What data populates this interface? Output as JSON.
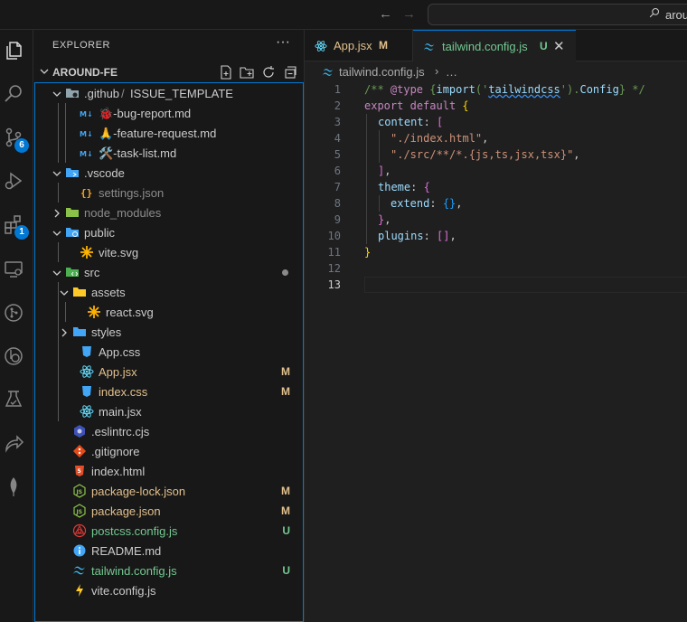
{
  "titlebar": {
    "search_text": "arou"
  },
  "activity_bar": {
    "items": [
      {
        "icon": "files-icon"
      },
      {
        "icon": "search-icon"
      },
      {
        "icon": "source-control-icon",
        "badge": "6"
      },
      {
        "icon": "run-debug-icon"
      },
      {
        "icon": "extensions-icon",
        "badge": "1"
      },
      {
        "icon": "remote-explorer-icon"
      },
      {
        "icon": "git-graph-icon"
      },
      {
        "icon": "gitlens-icon"
      },
      {
        "icon": "testing-icon"
      },
      {
        "icon": "live-share-icon"
      },
      {
        "icon": "mongodb-icon"
      }
    ]
  },
  "sidebar": {
    "title": "EXPLORER",
    "more": "···",
    "section_title": "AROUND-FE",
    "section_actions": [
      "new-file-icon",
      "new-folder-icon",
      "refresh-icon",
      "collapse-all-icon"
    ]
  },
  "tree": [
    {
      "depth": 1,
      "type": "folder",
      "expanded": true,
      "label": ".github",
      "label2": "ISSUE_TEMPLATE",
      "icon": "folder-github-icon",
      "color": "#cccccc"
    },
    {
      "depth": 3,
      "type": "file",
      "label": "🐞-bug-report.md",
      "icon": "markdown-icon",
      "color": "#cccccc"
    },
    {
      "depth": 3,
      "type": "file",
      "label": "🙏-feature-request.md",
      "icon": "markdown-icon",
      "color": "#cccccc"
    },
    {
      "depth": 3,
      "type": "file",
      "label": "🛠️-task-list.md",
      "icon": "markdown-icon",
      "color": "#cccccc"
    },
    {
      "depth": 1,
      "type": "folder",
      "expanded": true,
      "label": ".vscode",
      "icon": "folder-vscode-icon",
      "color": "#cccccc"
    },
    {
      "depth": 2,
      "type": "file",
      "label": "settings.json",
      "icon": "json-settings-icon",
      "color": "#8c8c8c"
    },
    {
      "depth": 1,
      "type": "folder",
      "expanded": false,
      "label": "node_modules",
      "icon": "folder-node-icon",
      "color": "#8c8c8c"
    },
    {
      "depth": 1,
      "type": "folder",
      "expanded": true,
      "label": "public",
      "icon": "folder-public-icon",
      "color": "#cccccc"
    },
    {
      "depth": 2,
      "type": "file",
      "label": "vite.svg",
      "icon": "svg-icon",
      "color": "#cccccc"
    },
    {
      "depth": 1,
      "type": "folder",
      "expanded": true,
      "label": "src",
      "icon": "folder-src-icon",
      "color": "#cccccc",
      "dot": true
    },
    {
      "depth": 2,
      "type": "folder",
      "expanded": true,
      "label": "assets",
      "icon": "folder-assets-icon",
      "color": "#cccccc"
    },
    {
      "depth": 3,
      "type": "file",
      "label": "react.svg",
      "icon": "svg-icon",
      "color": "#cccccc"
    },
    {
      "depth": 2,
      "type": "folder",
      "expanded": false,
      "label": "styles",
      "icon": "folder-styles-icon",
      "color": "#cccccc"
    },
    {
      "depth": 2,
      "type": "file",
      "label": "App.css",
      "icon": "css-icon",
      "color": "#cccccc"
    },
    {
      "depth": 2,
      "type": "file",
      "label": "App.jsx",
      "icon": "react-icon",
      "color": "#e2c08d",
      "status": "M"
    },
    {
      "depth": 2,
      "type": "file",
      "label": "index.css",
      "icon": "css-icon",
      "color": "#e2c08d",
      "status": "M"
    },
    {
      "depth": 2,
      "type": "file",
      "label": "main.jsx",
      "icon": "react-icon",
      "color": "#cccccc"
    },
    {
      "depth": 1,
      "type": "file",
      "label": ".eslintrc.cjs",
      "icon": "eslint-icon",
      "color": "#cccccc"
    },
    {
      "depth": 1,
      "type": "file",
      "label": ".gitignore",
      "icon": "git-icon",
      "color": "#cccccc"
    },
    {
      "depth": 1,
      "type": "file",
      "label": "index.html",
      "icon": "html-icon",
      "color": "#cccccc"
    },
    {
      "depth": 1,
      "type": "file",
      "label": "package-lock.json",
      "icon": "nodejs-icon",
      "color": "#e2c08d",
      "status": "M"
    },
    {
      "depth": 1,
      "type": "file",
      "label": "package.json",
      "icon": "nodejs-icon",
      "color": "#e2c08d",
      "status": "M"
    },
    {
      "depth": 1,
      "type": "file",
      "label": "postcss.config.js",
      "icon": "postcss-icon",
      "color": "#73c991",
      "status": "U"
    },
    {
      "depth": 1,
      "type": "file",
      "label": "README.md",
      "icon": "info-icon",
      "color": "#cccccc"
    },
    {
      "depth": 1,
      "type": "file",
      "label": "tailwind.config.js",
      "icon": "tailwind-icon",
      "color": "#73c991",
      "status": "U"
    },
    {
      "depth": 1,
      "type": "file",
      "label": "vite.config.js",
      "icon": "vite-icon",
      "color": "#cccccc"
    }
  ],
  "tabs": [
    {
      "label": "App.jsx",
      "status": "M",
      "color": "#e2c08d",
      "icon": "react-icon"
    },
    {
      "label": "tailwind.config.js",
      "status": "U",
      "color": "#73c991",
      "icon": "tailwind-icon",
      "active": true
    }
  ],
  "breadcrumb": {
    "file": "tailwind.config.js",
    "more": "…"
  },
  "code": {
    "current_line": 13,
    "lines": [
      {
        "n": "1"
      },
      {
        "n": "2"
      },
      {
        "n": "3"
      },
      {
        "n": "4"
      },
      {
        "n": "5"
      },
      {
        "n": "6"
      },
      {
        "n": "7"
      },
      {
        "n": "8"
      },
      {
        "n": "9"
      },
      {
        "n": "10"
      },
      {
        "n": "11"
      },
      {
        "n": "12"
      },
      {
        "n": "13"
      }
    ],
    "tokens": {
      "l1a": "/** ",
      "l1b": "@type",
      "l1c": " {",
      "l1d": "import",
      "l1e": "('",
      "l1f": "tailwindcss",
      "l1g": "').",
      "l1h": "Config",
      "l1i": "} */",
      "l2a": "export",
      "l2b": " ",
      "l2c": "default",
      "l2d": " ",
      "l2e": "{",
      "l3a": "content",
      "l3b": ": ",
      "l3c": "[",
      "l4a": "\"./index.html\"",
      "l4b": ",",
      "l5a": "\"./src/**/*.{js,ts,jsx,tsx}\"",
      "l5b": ",",
      "l6a": "]",
      "l6b": ",",
      "l7a": "theme",
      "l7b": ": ",
      "l7c": "{",
      "l8a": "extend",
      "l8b": ": ",
      "l8c": "{}",
      "l8d": ",",
      "l9a": "}",
      "l9b": ",",
      "l10a": "plugins",
      "l10b": ": ",
      "l10c": "[]",
      "l10d": ",",
      "l11a": "}"
    }
  }
}
